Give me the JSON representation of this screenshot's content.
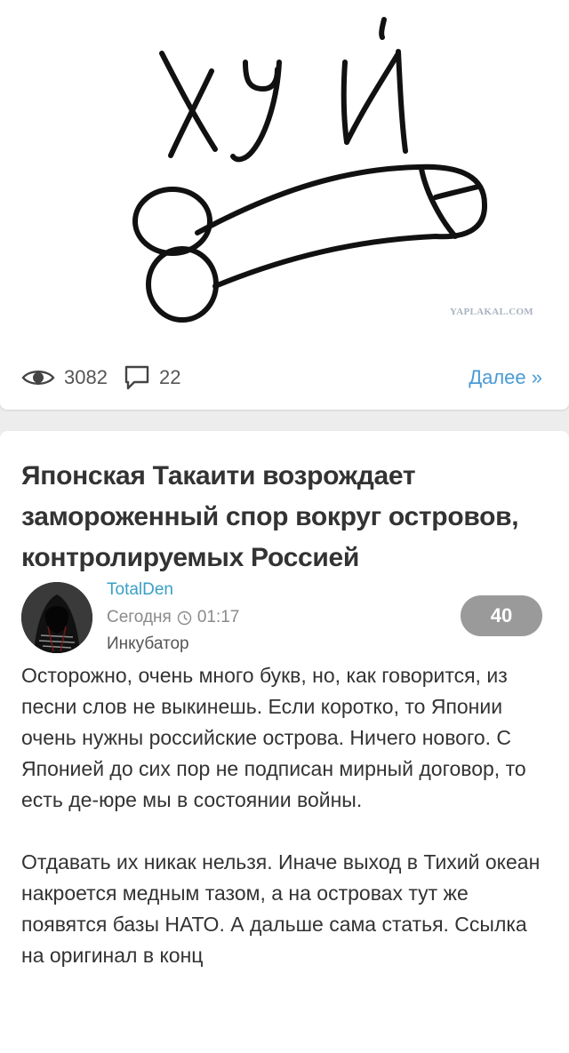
{
  "top_post": {
    "image": {
      "drawn_text": "ХУЙ",
      "watermark": "YAPLAKAL.COM"
    },
    "stats": {
      "views_icon": "eye-icon",
      "views": "3082",
      "comments_icon": "comment-icon",
      "comments": "22"
    },
    "more_label": "Далее »"
  },
  "post": {
    "title": "Японская Такаити возрождает замороженный спор вокруг островов, контролируемых Россией",
    "author": "TotalDen",
    "date": "Сегодня",
    "time": "01:17",
    "section": "Инкубатор",
    "rating": "40",
    "body": [
      "Осторожно, очень много букв, но, как говорится, из песни слов не выкинешь. Если коротко, то Японии очень нужны российские острова. Ничего нового. С Японией до сих пор не подписан мирный договор, то есть де-юре мы в состоянии войны.",
      "Отдавать их никак нельзя. Иначе выход в Тихий океан накроется медным тазом, а на островах тут же появятся базы НАТО. А дальше сама статья. Ссылка на оригинал в конц"
    ]
  },
  "colors": {
    "link": "#4a9bd6",
    "author": "#3a9fc7",
    "rating_bg": "#9a9a9a",
    "page_bg": "#ededed"
  }
}
